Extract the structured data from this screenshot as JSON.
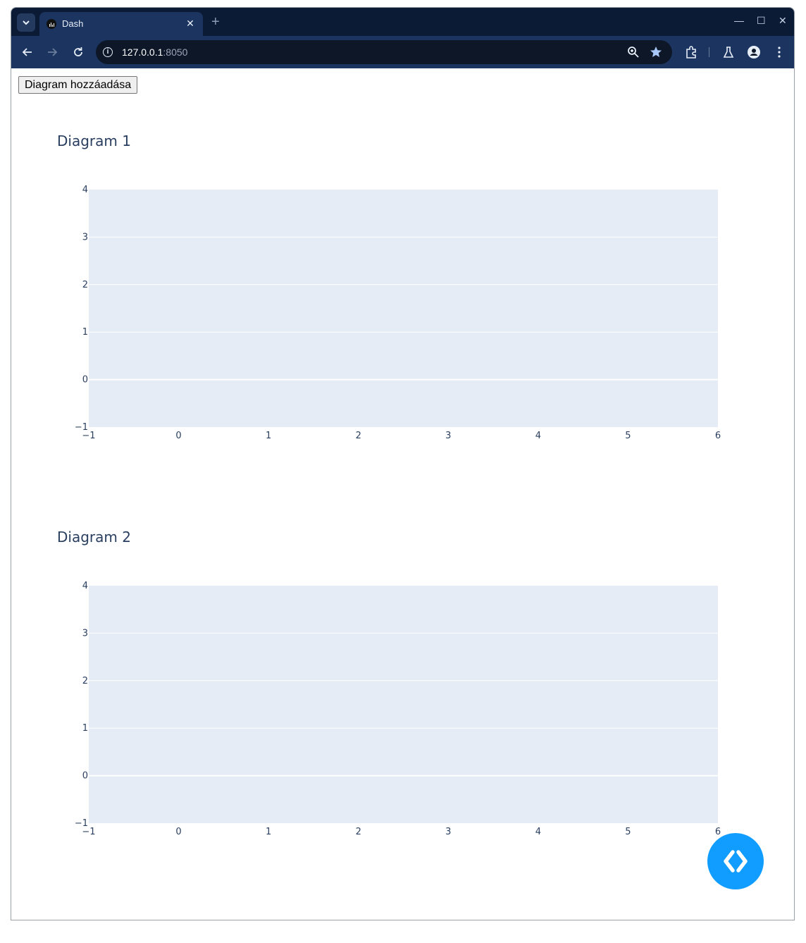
{
  "browser": {
    "tab_title": "Dash",
    "url_host": "127.0.0.1",
    "url_port": ":8050"
  },
  "page": {
    "add_button_label": "Diagram hozzáadása"
  },
  "chart_data": [
    {
      "type": "scatter",
      "title": "Diagram 1",
      "xlim": [
        -1,
        6
      ],
      "ylim": [
        -1,
        4
      ],
      "x_ticks": [
        "−1",
        "0",
        "1",
        "2",
        "3",
        "4",
        "5",
        "6"
      ],
      "y_ticks": [
        "4",
        "3",
        "2",
        "1",
        "0",
        "−1"
      ],
      "series": [],
      "grid": true,
      "plot_bgcolor": "#e5ecf6"
    },
    {
      "type": "scatter",
      "title": "Diagram 2",
      "xlim": [
        -1,
        6
      ],
      "ylim": [
        -1,
        4
      ],
      "x_ticks": [
        "−1",
        "0",
        "1",
        "2",
        "3",
        "4",
        "5",
        "6"
      ],
      "y_ticks": [
        "4",
        "3",
        "2",
        "1",
        "0",
        "−1"
      ],
      "series": [],
      "grid": true,
      "plot_bgcolor": "#e5ecf6"
    }
  ],
  "colors": {
    "tabstrip": "#0b1b36",
    "toolbar": "#1b3460",
    "fab": "#119dff",
    "axis_text": "#2a3f5f"
  },
  "icons": [
    "tab-search-icon",
    "dash-favicon-icon",
    "close-icon",
    "new-tab-icon",
    "minimize-icon",
    "maximize-icon",
    "window-close-icon",
    "back-icon",
    "forward-icon",
    "reload-icon",
    "info-icon",
    "zoom-icon",
    "bookmark-star-icon",
    "extensions-icon",
    "labs-icon",
    "profile-icon",
    "menu-icon",
    "dev-tools-icon"
  ]
}
